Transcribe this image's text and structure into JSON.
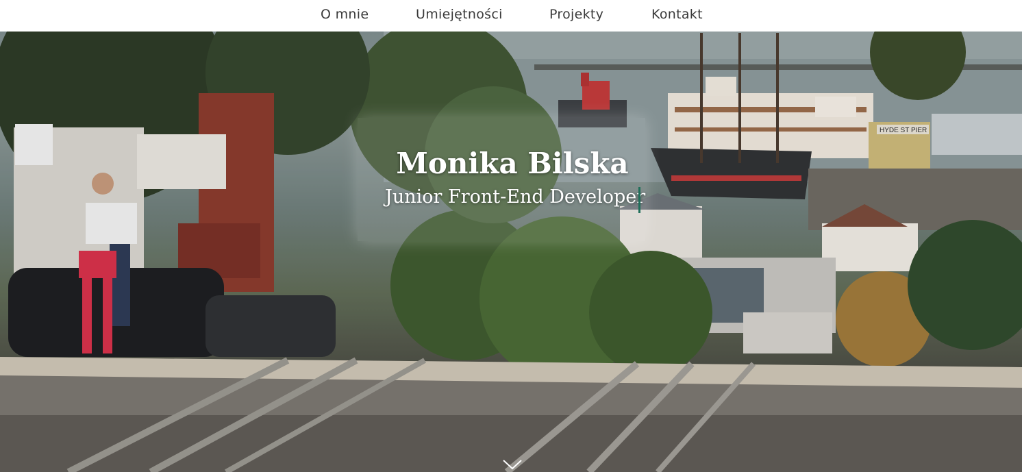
{
  "nav": {
    "items": [
      {
        "label": "O mnie"
      },
      {
        "label": "Umiejętności"
      },
      {
        "label": "Projekty"
      },
      {
        "label": "Kontakt"
      }
    ]
  },
  "hero": {
    "name": "Monika Bilska",
    "role": "Junior Front-End Developer",
    "pier_sign": "HYDE ST PIER",
    "scroll_icon": "chevron-down-icon"
  },
  "colors": {
    "nav_background": "#ffffff",
    "nav_text": "#3a3a3a",
    "hero_text": "#ffffff",
    "caret": "#1f6f5a"
  }
}
